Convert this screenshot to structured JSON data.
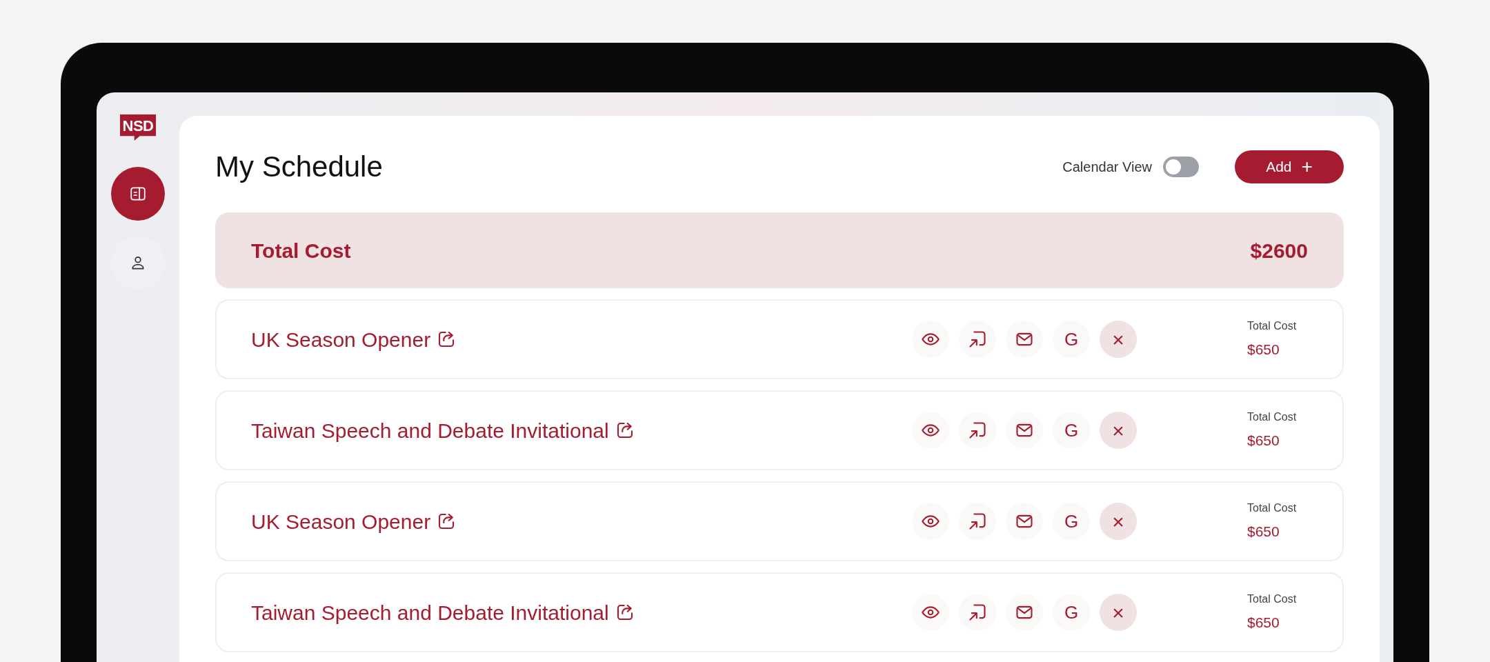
{
  "logo": {
    "text": "NSD"
  },
  "nav": [
    {
      "kind": "schedule",
      "selected": true
    },
    {
      "kind": "profile",
      "selected": false
    }
  ],
  "header": {
    "title": "My Schedule",
    "calendar_view": {
      "label": "Calendar View",
      "on": false
    },
    "add_button": {
      "label": "Add",
      "icon": "+"
    }
  },
  "summary": {
    "label": "Total Cost",
    "value": "$2600"
  },
  "events": [
    {
      "title": "UK Season Opener",
      "actions": [
        {
          "kind": "view"
        },
        {
          "kind": "open"
        },
        {
          "kind": "email"
        },
        {
          "kind": "google",
          "label": "G"
        },
        {
          "kind": "remove",
          "label": "×"
        }
      ],
      "cost_label": "Total Cost",
      "cost": "$650"
    },
    {
      "title": "Taiwan Speech and Debate Invitational",
      "actions": [
        {
          "kind": "view"
        },
        {
          "kind": "open"
        },
        {
          "kind": "email"
        },
        {
          "kind": "google",
          "label": "G"
        },
        {
          "kind": "remove",
          "label": "×"
        }
      ],
      "cost_label": "Total Cost",
      "cost": "$650"
    },
    {
      "title": "UK Season Opener",
      "actions": [
        {
          "kind": "view"
        },
        {
          "kind": "open"
        },
        {
          "kind": "email"
        },
        {
          "kind": "google",
          "label": "G"
        },
        {
          "kind": "remove",
          "label": "×"
        }
      ],
      "cost_label": "Total Cost",
      "cost": "$650"
    },
    {
      "title": "Taiwan Speech and Debate Invitational",
      "actions": [
        {
          "kind": "view"
        },
        {
          "kind": "open"
        },
        {
          "kind": "email"
        },
        {
          "kind": "google",
          "label": "G"
        },
        {
          "kind": "remove",
          "label": "×"
        }
      ],
      "cost_label": "Total Cost",
      "cost": "$650"
    }
  ]
}
